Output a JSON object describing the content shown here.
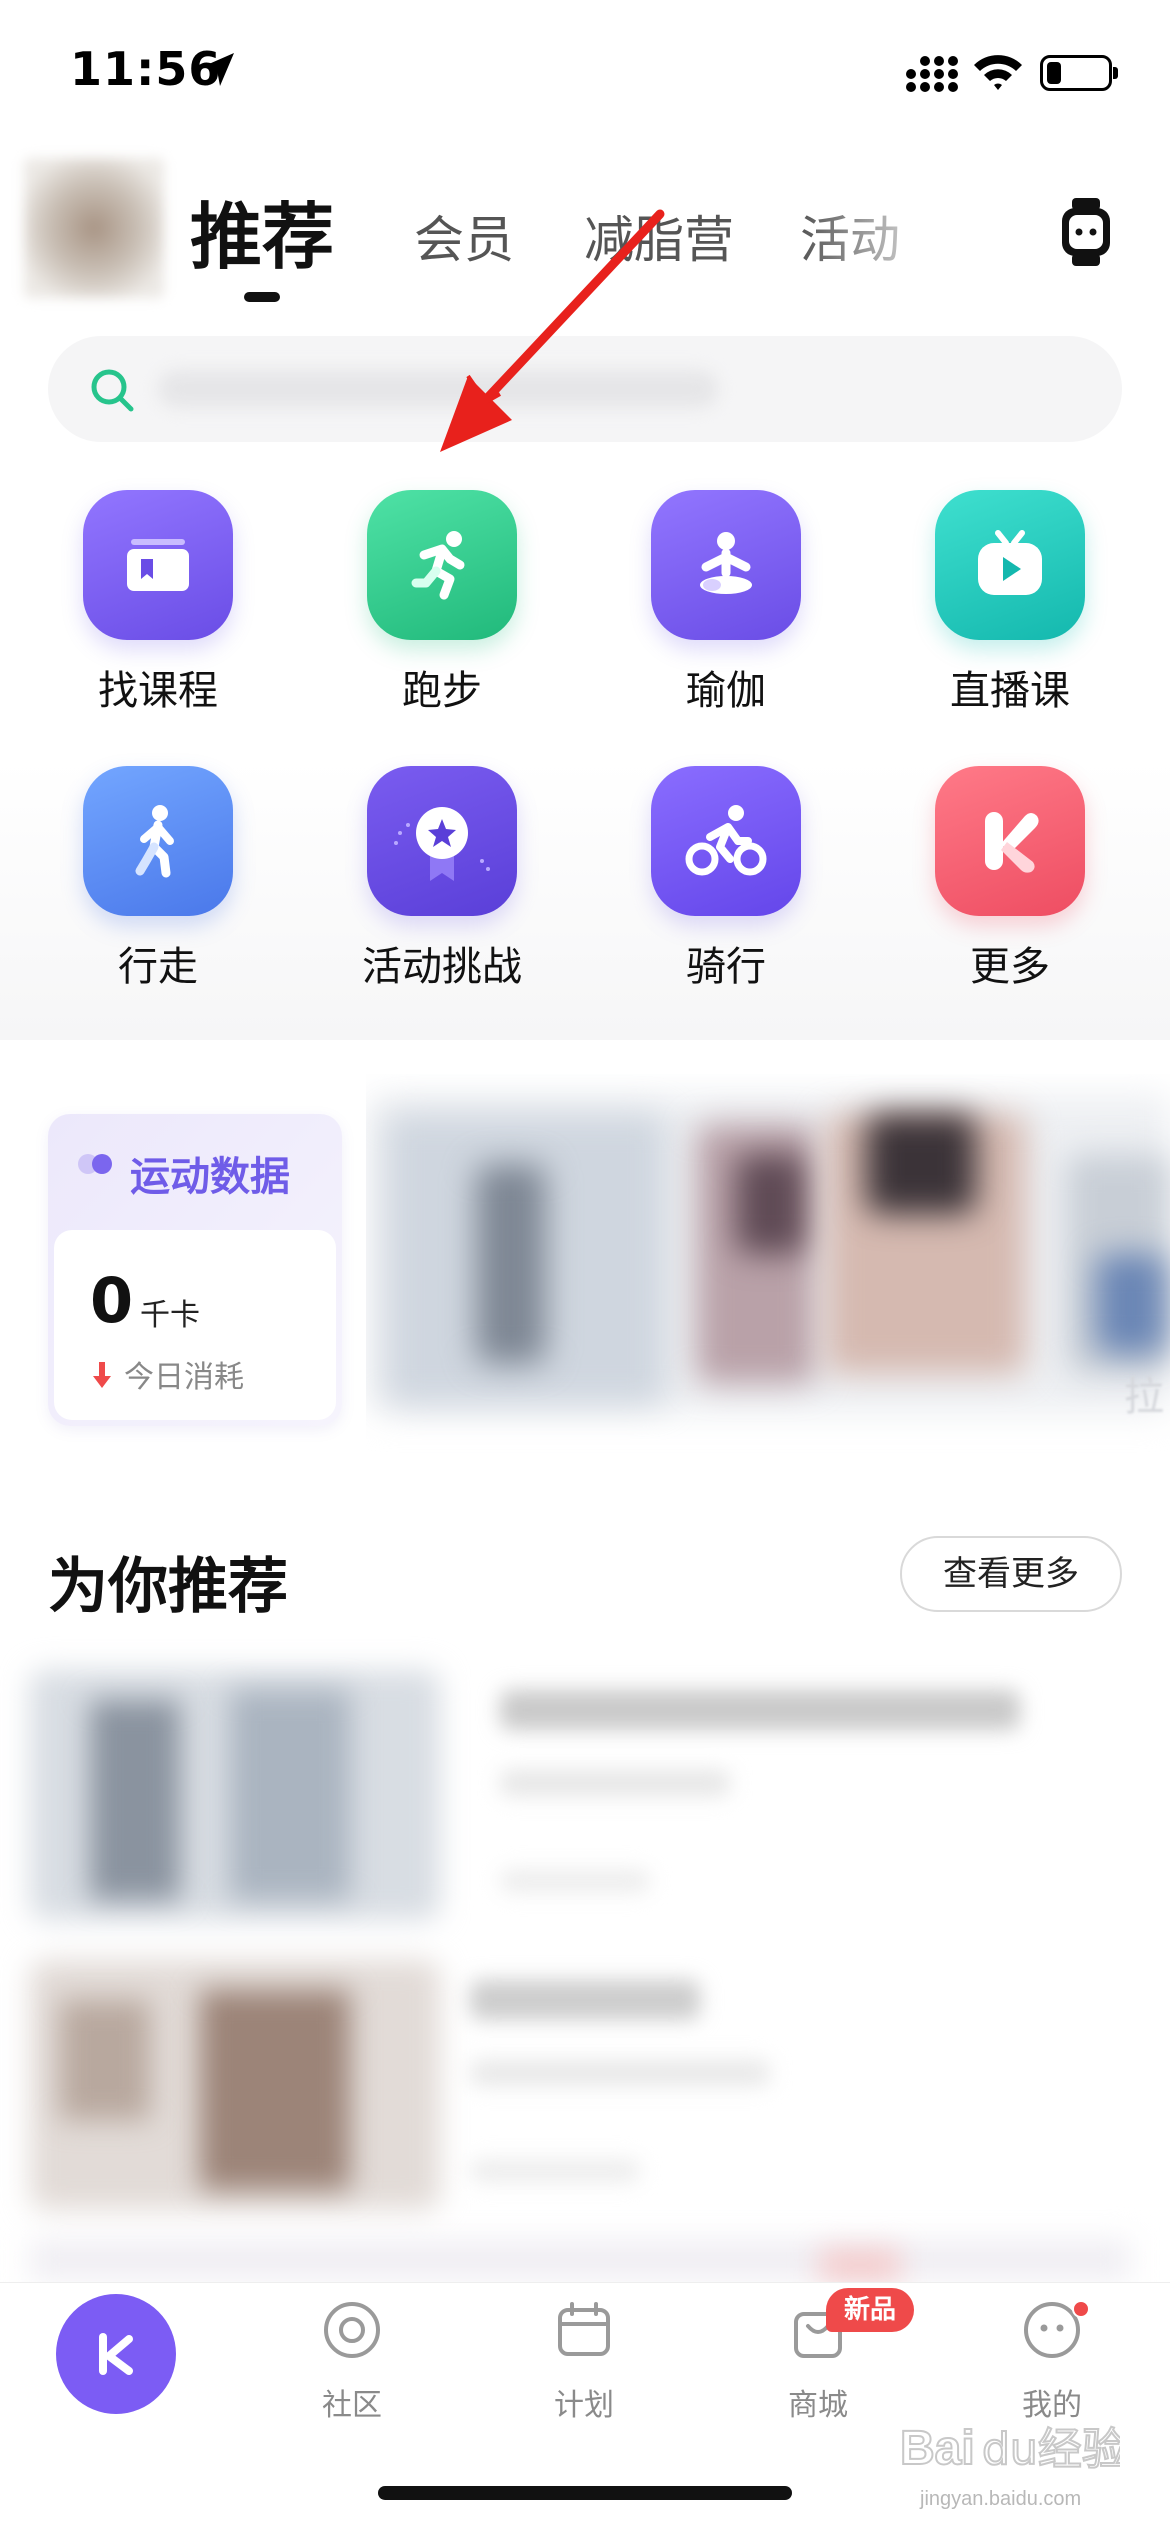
{
  "status_bar": {
    "time": "11:56"
  },
  "header": {
    "active_tab": "推荐",
    "tabs": [
      "会员",
      "减脂营",
      "活动"
    ]
  },
  "grid": {
    "items": [
      {
        "label": "找课程",
        "icon": "course-book-icon",
        "color": "#7b5cf5"
      },
      {
        "label": "跑步",
        "icon": "running-icon",
        "color": "#2ecf8e"
      },
      {
        "label": "瑜伽",
        "icon": "yoga-icon",
        "color": "#7b5cf5"
      },
      {
        "label": "直播课",
        "icon": "live-tv-icon",
        "color": "#22cdbf"
      },
      {
        "label": "行走",
        "icon": "walking-icon",
        "color": "#5b8cf5"
      },
      {
        "label": "活动挑战",
        "icon": "challenge-medal-icon",
        "color": "#6a4fe6"
      },
      {
        "label": "骑行",
        "icon": "cycling-icon",
        "color": "#6d52f0"
      },
      {
        "label": "更多",
        "icon": "keep-k-icon",
        "color": "#f25f72"
      }
    ]
  },
  "sport_data": {
    "title": "运动数据",
    "value": "0",
    "unit": "千卡",
    "subtitle": "今日消耗"
  },
  "banner": {
    "overlay_text": "拉"
  },
  "recommend": {
    "title": "为你推荐",
    "more_label": "查看更多"
  },
  "tabbar": {
    "items": [
      {
        "label": "社区",
        "icon": "community-icon"
      },
      {
        "label": "计划",
        "icon": "calendar-icon"
      },
      {
        "label": "商城",
        "icon": "shop-bag-icon"
      },
      {
        "label": "我的",
        "icon": "profile-icon"
      }
    ],
    "badge": "新品"
  },
  "watermark": {
    "text": "Baidu经验",
    "url": "jingyan.baidu.com"
  },
  "colors": {
    "accent": "#7c5cf4",
    "green": "#2ecf8e",
    "badge_red": "#ef4a4a",
    "annotation_red": "#e8211c"
  }
}
